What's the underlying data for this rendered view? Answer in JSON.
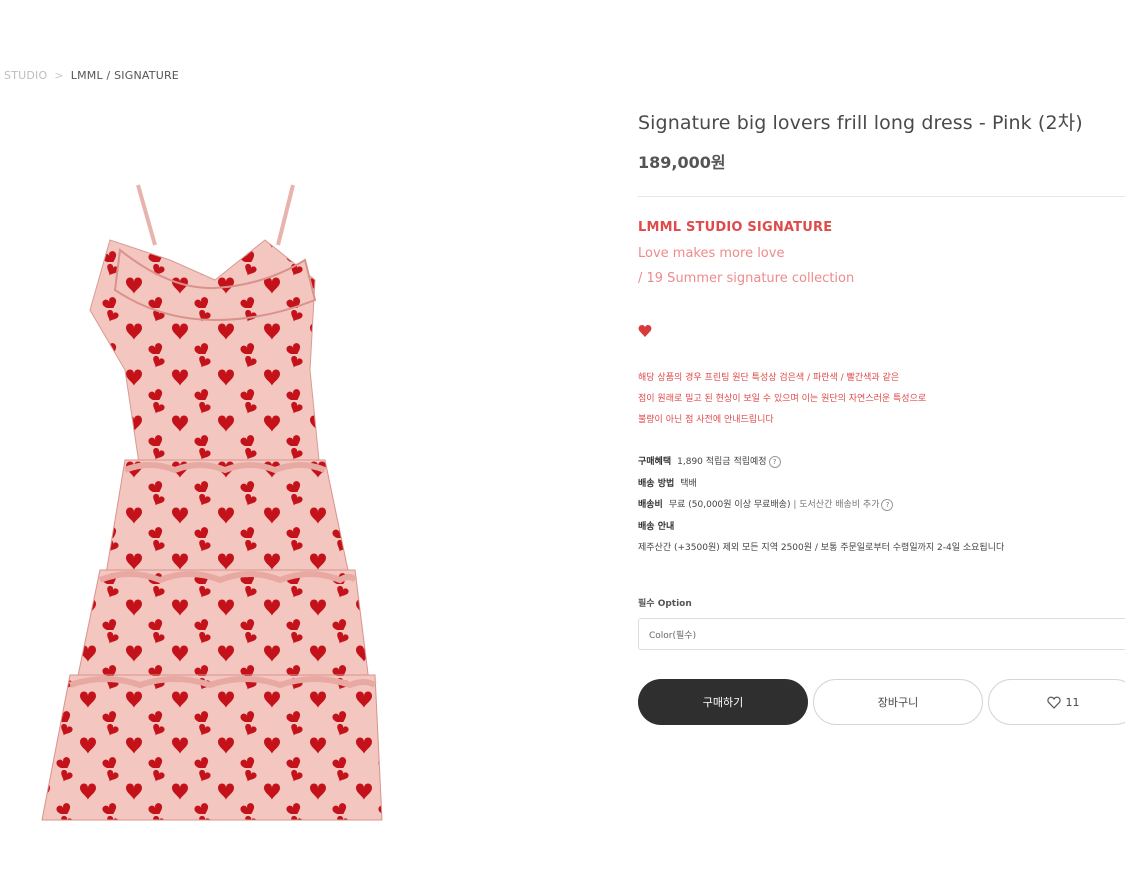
{
  "breadcrumb": {
    "parent": "L STUDIO",
    "separator": ">",
    "current": "LMML / SIGNATURE"
  },
  "product": {
    "title": "Signature big lovers frill long dress - Pink (2차)",
    "price": "189,000원",
    "brand": "LMML STUDIO SIGNATURE",
    "tagline_1": "Love makes more love",
    "tagline_2": "/ 19 Summer signature collection",
    "image_alt": "pink dress with red heart print"
  },
  "notice": {
    "line1": "해당 상품의 경우 프린팅 원단 특성상 검은색 / 파란색 / 빨간색과 같은",
    "line2": "점이 원래로 밀고 된 현상이 보일 수 있으며 이는 원단의 자연스러운 특성으로",
    "line3": "불량이 아닌 점 사전에 안내드립니다"
  },
  "meta": {
    "benefit_label": "구매혜택",
    "benefit_value": "1,890 적립금 적립예정",
    "shipping_method_label": "배송 방법",
    "shipping_method_value": "택배",
    "shipping_fee_label": "배송비",
    "shipping_fee_value": "무료 (50,000원 이상 무료배송)",
    "shipping_fee_extra": "| 도서산간 배송비 추가",
    "shipping_info_label": "배송 안내",
    "shipping_info_value": "제주산간 (+3500원) 제외 모든 지역 2500원 / 보통 주문일로부터 수령일까지 2-4일 소요됩니다"
  },
  "option": {
    "label": "필수 Option",
    "select_value": "Color(필수)"
  },
  "actions": {
    "buy_label": "구매하기",
    "cart_label": "장바구니",
    "like_count": "11"
  },
  "colors": {
    "accent_red": "#e04a4a",
    "accent_pink": "#ee8b8b",
    "buy_button": "#2f2f2f"
  }
}
